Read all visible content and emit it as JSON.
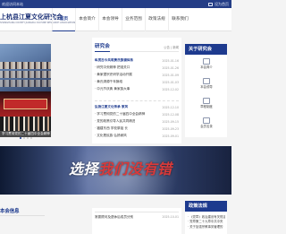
{
  "topbar": {
    "slogan": "欢迎访问本站",
    "home_label": "设为首页"
  },
  "header": {
    "logo_cn": "上杭县江夏文化研究会",
    "logo_en": "SHANGHANG COUNTY JIANGXIA CULTURE RESEARCH ASSOCIATION"
  },
  "nav": {
    "items": [
      {
        "label": "首页"
      },
      {
        "label": "本会简介"
      },
      {
        "label": "本会领导"
      },
      {
        "label": "业务范围"
      },
      {
        "label": "政策法规"
      },
      {
        "label": "联系我们"
      }
    ]
  },
  "slideshow": {
    "caption": "学习贯彻党的二十届四中全会精神"
  },
  "research": {
    "title": "研究会",
    "more_label": "公告  |  新闻",
    "list1": [
      {
        "title": "纵贯古今共筑黄氏族谱体系",
        "date": "2025-01-16",
        "highlight": true
      },
      {
        "title": "· 研究中央精神 把准关口",
        "date": "2025-01-26",
        "highlight": false
      },
      {
        "title": "· 黄家潭宗史研学活动开展",
        "date": "2025-01-09",
        "highlight": false
      },
      {
        "title": "· 黄氏溯源千年脉络",
        "date": "2025-01-03",
        "highlight": false
      },
      {
        "title": "· 中元节庆典 黄家族大事",
        "date": "2025-12-02",
        "highlight": false
      }
    ],
    "list2": [
      {
        "title": "弘扬江夏文化传承 家风",
        "date": "2025-12-10",
        "highlight": true
      },
      {
        "title": "· 学习贯彻党的二十届四中全会精神",
        "date": "2025-12-08",
        "highlight": false
      },
      {
        "title": "· 党的政策引导人民共同精进",
        "date": "2025-09-15",
        "highlight": false
      },
      {
        "title": "· 福建东西 学校祭祖 长",
        "date": "2025-09-23",
        "highlight": false
      },
      {
        "title": "· 文化是民族   弘扬家风",
        "date": "2025-09-01",
        "highlight": false
      }
    ]
  },
  "association": {
    "title": "关于研究会",
    "items": [
      {
        "label": "本会简介",
        "icon": "building-icon"
      },
      {
        "label": "本会领导",
        "icon": "people-icon"
      },
      {
        "label": "章程制度",
        "icon": "document-icon"
      },
      {
        "label": "会员名录",
        "icon": "book-icon"
      }
    ]
  },
  "band": {
    "slogan_a": "选择",
    "slogan_b": "我们没有错"
  },
  "bottom": {
    "left_title": "本会信息",
    "mid_item_title": "常委顾问及退休后成员分别",
    "mid_item_date": "2025-10-01",
    "right_title": "政策法规",
    "right_items": [
      "· 《党章》政治建设有关规定",
      "· 党章第二十九章中共中央",
      "· 关于加强宗教事务管理的"
    ]
  },
  "colors": {
    "brand": "#1d3a8e",
    "topbar": "#243d86",
    "accent_red": "#d93a3a"
  }
}
